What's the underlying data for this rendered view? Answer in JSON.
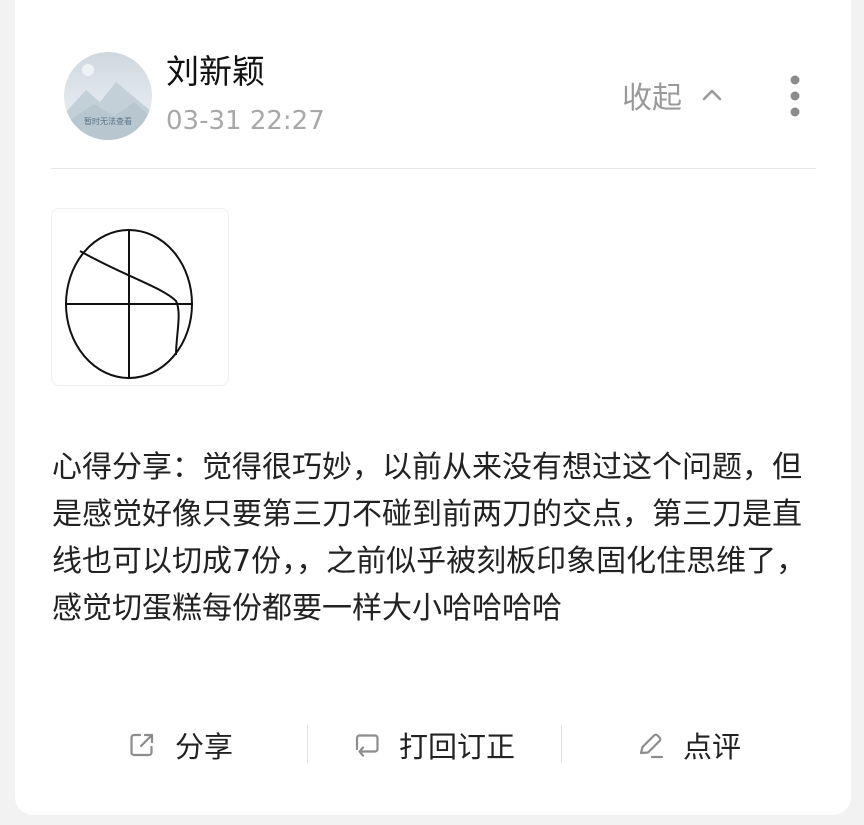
{
  "post": {
    "author": {
      "name": "刘新颖",
      "avatar_caption": "暂时无法查看"
    },
    "time": "03-31 22:27",
    "collapse_label": "收起",
    "text": "心得分享：觉得很巧妙，以前从来没有想过这个问题，但是感觉好像只要第三刀不碰到前两刀的交点，第三刀是直线也可以切成7份，，之前似乎被刻板印象固化住思维了，感觉切蛋糕每份都要一样大小哈哈哈哈"
  },
  "actions": {
    "share_label": "分享",
    "return_label": "打回订正",
    "comment_label": "点评"
  },
  "icons": {
    "more": "more-vertical-icon",
    "collapse": "chevron-up-icon",
    "share": "share-icon",
    "return": "return-icon",
    "comment": "pencil-icon"
  }
}
